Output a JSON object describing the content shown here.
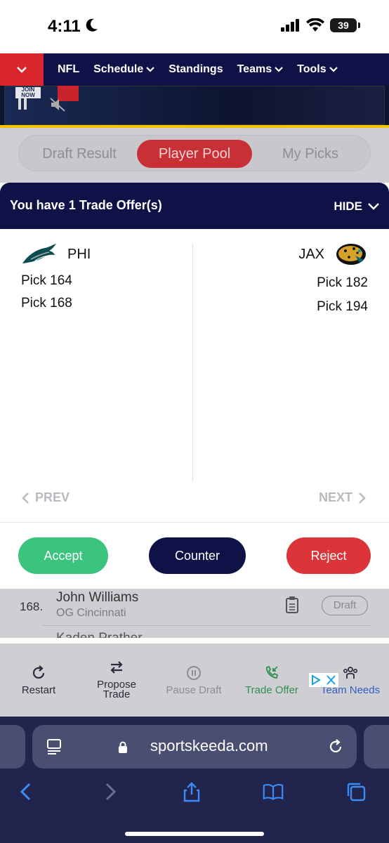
{
  "status": {
    "time": "4:11",
    "battery": "39"
  },
  "nav": {
    "items": [
      "NFL",
      "Schedule",
      "Standings",
      "Teams",
      "Tools"
    ]
  },
  "video": {
    "badge_text": "JOIN NOW"
  },
  "tabs": [
    "Draft Result",
    "Player Pool",
    "My Picks"
  ],
  "trade": {
    "title": "You have 1 Trade Offer(s)",
    "hide_label": "HIDE",
    "left_team": {
      "abbr": "PHI",
      "picks": [
        "Pick 164",
        "Pick 168"
      ],
      "logo_icon": "eagles-logo-icon"
    },
    "right_team": {
      "abbr": "JAX",
      "picks": [
        "Pick 182",
        "Pick 194"
      ],
      "logo_icon": "jaguars-logo-icon"
    },
    "prev_label": "PREV",
    "next_label": "NEXT",
    "accept_label": "Accept",
    "counter_label": "Counter",
    "reject_label": "Reject"
  },
  "list_row": {
    "number": "168.",
    "name": "John Williams",
    "position": "OG Cincinnati",
    "draft_label": "Draft",
    "next_name": "Kaden Prather"
  },
  "toolbar": {
    "restart": "Restart",
    "propose_1": "Propose",
    "propose_2": "Trade",
    "pause": "Pause Draft",
    "trade_offer": "Trade Offer",
    "team_needs": "Team Needs"
  },
  "safari": {
    "url": "sportskeeda.com"
  },
  "colors": {
    "navy": "#0f1247",
    "accept": "#3ac47d",
    "reject": "#db3539",
    "brand_red": "#d8262b"
  }
}
